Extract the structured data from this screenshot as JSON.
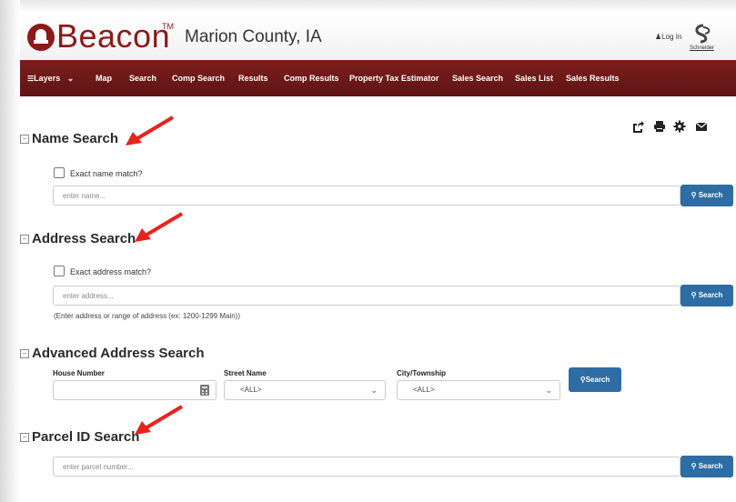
{
  "header": {
    "logo_text": "Beacon",
    "trademark": "TM",
    "county": "Marion County, IA",
    "login": "Log In",
    "vendor": "Schneider"
  },
  "nav": {
    "items": [
      "Layers",
      "Map",
      "Search",
      "Comp Search",
      "Results",
      "Comp Results",
      "Property Tax Estimator",
      "Sales Search",
      "Sales List",
      "Sales Results"
    ]
  },
  "toolbar": {
    "icons": [
      "share-icon",
      "print-icon",
      "gear-icon",
      "email-icon"
    ]
  },
  "name_search": {
    "title": "Name Search",
    "checkbox_label": "Exact name match?",
    "placeholder": "enter name...",
    "button": "Search"
  },
  "address_search": {
    "title": "Address Search",
    "checkbox_label": "Exact address match?",
    "placeholder": "enter address...",
    "button": "Search",
    "hint": "(Enter address or range of address (ex: 1200-1299 Main))"
  },
  "advanced_address_search": {
    "title": "Advanced Address Search",
    "house_number_label": "House Number",
    "street_name_label": "Street Name",
    "street_name_value": "<ALL>",
    "city_label": "City/Township",
    "city_value": "<ALL>",
    "button": "Search"
  },
  "parcel_search": {
    "title": "Parcel ID Search",
    "placeholder": "enter parcel number...",
    "button": "Search"
  },
  "colors": {
    "brand": "#8b1a1a",
    "nav_bg": "#6b1818",
    "button": "#2e6da4",
    "annotation_arrow": "#e8231d"
  }
}
